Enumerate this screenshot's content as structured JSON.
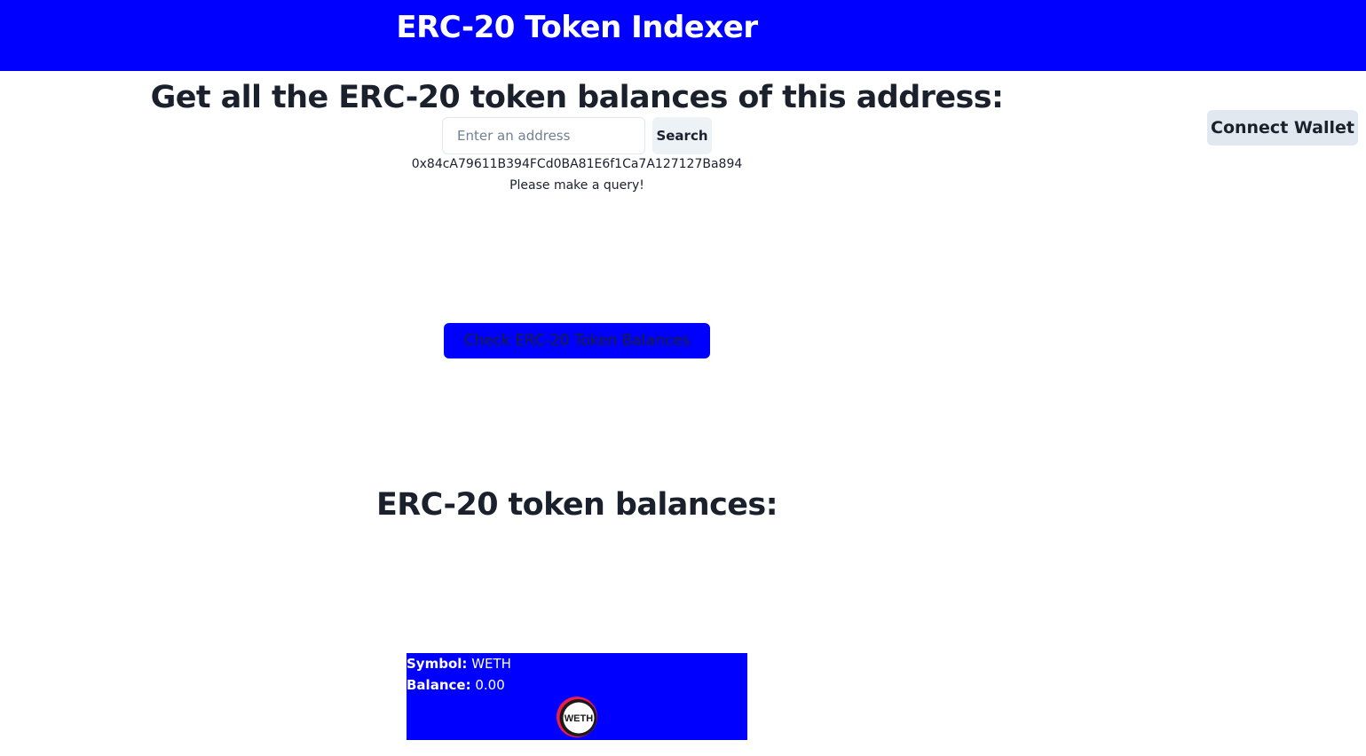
{
  "header": {
    "title": "ERC-20 Token Indexer"
  },
  "wallet": {
    "connect_label": "Connect Wallet"
  },
  "query": {
    "heading": "Get all the ERC-20 token balances of this address:",
    "input_placeholder": "Enter an address",
    "input_value": "",
    "search_label": "Search",
    "address": "0x84cA79611B394FCd0BA81E6f1Ca7A127127Ba894",
    "status": "Please make a query!",
    "check_label": "Check ERC-20 Token Balances"
  },
  "balances": {
    "heading": "ERC-20 token balances:",
    "tokens": [
      {
        "symbol_label": "Symbol:",
        "symbol": "WETH",
        "balance_label": "Balance:",
        "balance": "0.00",
        "logo_text": "WETH",
        "logo_icon": "weth-logo-icon"
      }
    ]
  },
  "colors": {
    "primary": "#0000ff",
    "button_gray": "#e2e8f0",
    "text_dark": "#1a202c",
    "white": "#ffffff"
  }
}
